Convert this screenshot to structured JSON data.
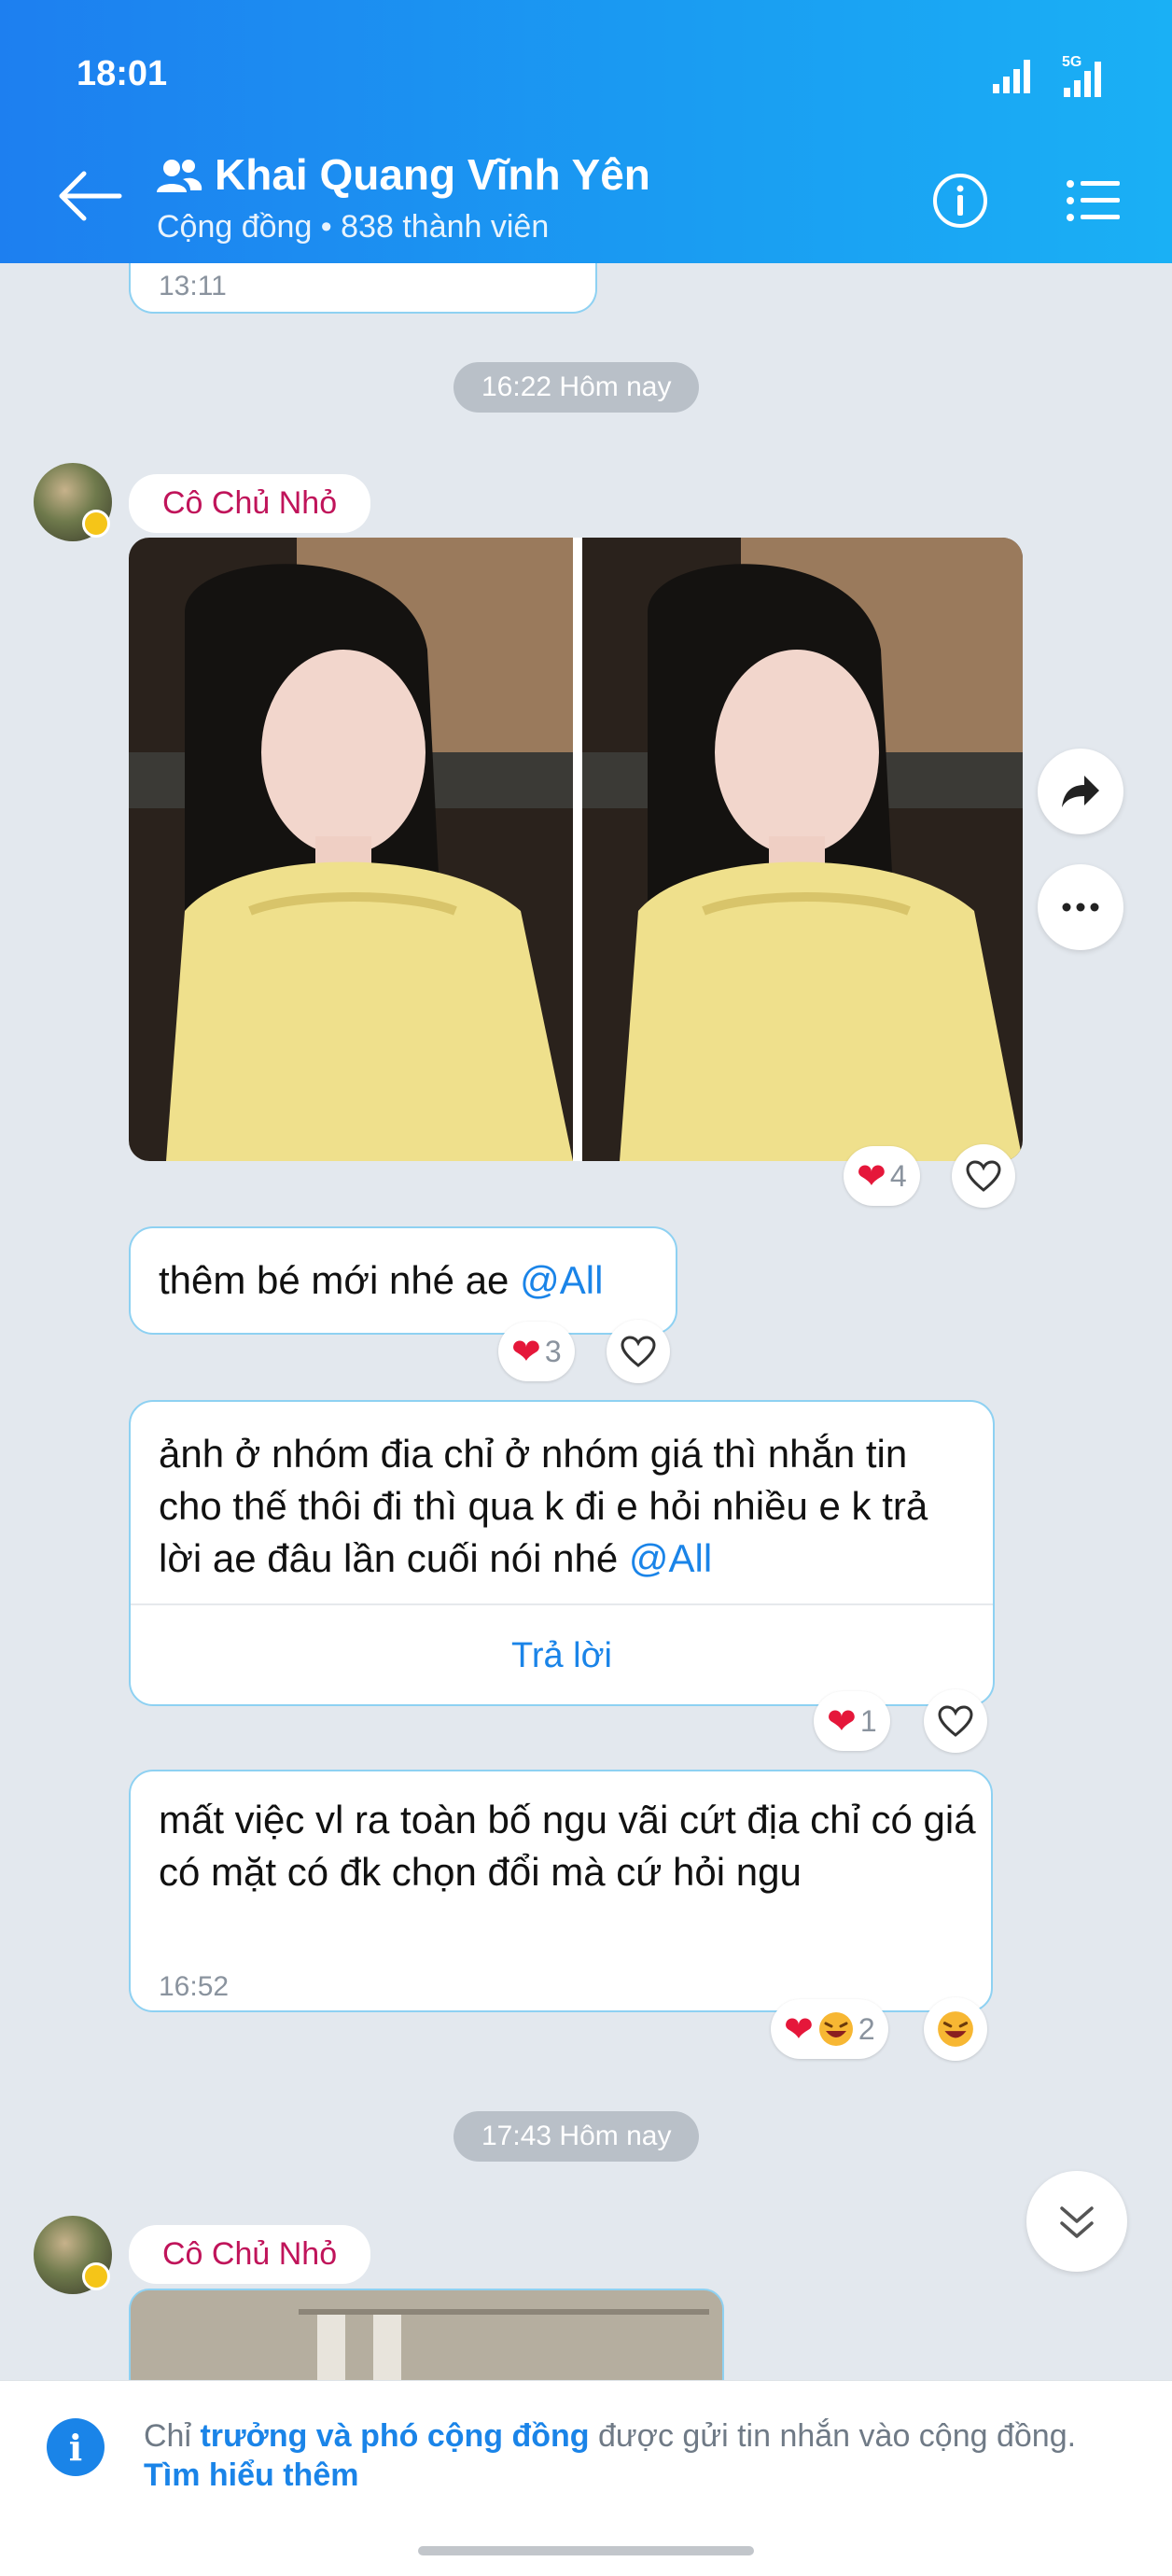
{
  "status_bar": {
    "time": "18:01",
    "network": "5G"
  },
  "header": {
    "title": "Khai Quang Vĩnh Yên",
    "subtitle": "Cộng đồng • 838 thành viên"
  },
  "previous_message": {
    "time": "13:11"
  },
  "timestamps": [
    "16:22 Hôm nay",
    "17:43 Hôm nay"
  ],
  "sender_name": "Cô Chủ Nhỏ",
  "album": {
    "reaction_count": "4"
  },
  "messages": [
    {
      "text": "thêm bé mới nhé ae ",
      "mention": "@All",
      "reaction_count": "3"
    },
    {
      "text": "ảnh ở nhóm đia chỉ ở nhóm giá thì nhắn tin cho thế thôi đi thì qua k đi e hỏi nhiều e k trả lời ae đâu lần cuối nói nhé ",
      "mention": "@All",
      "reply_label": "Trả lời",
      "reaction_count": "1"
    },
    {
      "text": "mất việc vl ra toàn bố ngu vãi cứt địa chỉ có giá có mặt có đk chọn đổi mà cứ hỏi ngu",
      "time": "16:52",
      "reaction_count": "2"
    }
  ],
  "footer": {
    "prefix": "Chỉ ",
    "highlight": "trưởng và phó cộng đồng",
    "suffix": " được gửi tin nhắn vào cộng đồng.",
    "link": "Tìm hiểu thêm"
  },
  "colors": {
    "accent": "#1a84e8",
    "header": "#1d7ff0",
    "sender": "#c0145a",
    "heart": "#e5173a"
  }
}
